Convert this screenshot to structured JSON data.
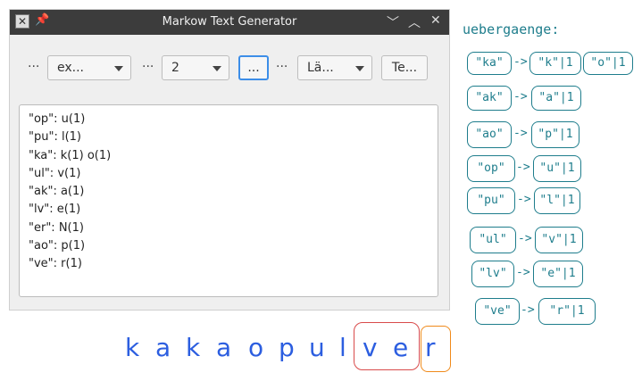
{
  "window": {
    "title": "Markow Text Generator",
    "controls": [
      "﹀",
      "︿",
      "✕"
    ]
  },
  "toolbar": {
    "dots": "···",
    "combo1": "ex...",
    "combo2": "2",
    "browse_button": "...",
    "combo3": "Lä...",
    "generate_button": "Te..."
  },
  "output_lines": [
    "\"op\": u(1)",
    "\"pu\": l(1)",
    "\"ka\": k(1) o(1)",
    "\"ul\": v(1)",
    "\"ak\": a(1)",
    "\"lv\": e(1)",
    "\"er\": N(1)",
    "\"ao\": p(1)",
    "\"ve\": r(1)"
  ],
  "annotations": {
    "heading": "uebergaenge:",
    "arrow": "->",
    "rows": [
      {
        "from": "\"ka\"",
        "to": [
          "\"k\"|1",
          "\"o\"|1"
        ]
      },
      {
        "from": "\"ak\"",
        "to": [
          "\"a\"|1"
        ]
      },
      {
        "from": "\"ao\"",
        "to": [
          "\"p\"|1"
        ]
      },
      {
        "from": "\"op\"",
        "to": [
          "\"u\"|1"
        ]
      },
      {
        "from": "\"pu\"",
        "to": [
          "\"l\"|1"
        ]
      },
      {
        "from": "\"ul\"",
        "to": [
          "\"v\"|1"
        ]
      },
      {
        "from": "\"lv\"",
        "to": [
          "\"e\"|1"
        ]
      },
      {
        "from": "\"ve\"",
        "to": [
          "\"r\"|1"
        ]
      }
    ],
    "generated_word": [
      "k",
      "a",
      "k",
      "a",
      "o",
      "p",
      "u",
      "l",
      "v",
      "e",
      "r"
    ]
  },
  "colors": {
    "annotation": "#1e7d8c",
    "word": "#2c5ee0",
    "highlight_red": "#d94b4b",
    "highlight_orange": "#f08a1a",
    "focus": "#3d8ee8"
  }
}
